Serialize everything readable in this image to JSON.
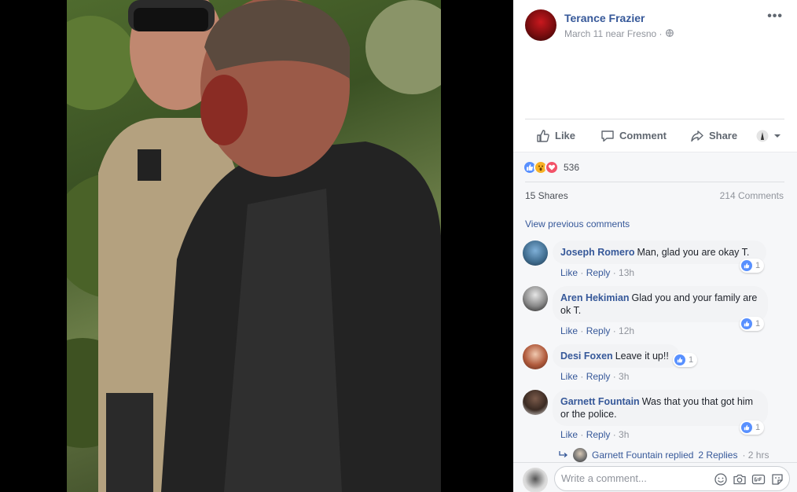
{
  "post": {
    "author": "Terance Frazier",
    "meta": "March 11 near Fresno ·",
    "more_icon": "more-horizontal-icon",
    "privacy_icon": "globe-icon"
  },
  "actions": {
    "like": "Like",
    "comment": "Comment",
    "share": "Share"
  },
  "stats": {
    "reaction_count": "536",
    "shares": "15 Shares",
    "comments": "214 Comments"
  },
  "view_previous": "View previous comments",
  "comments": [
    {
      "name": "Joseph Romero",
      "text": "Man, glad you are okay T.",
      "like": "Like",
      "reply": "Reply",
      "time": "13h",
      "likes": "1"
    },
    {
      "name": "Aren Hekimian",
      "text": "Glad you and your family are ok T.",
      "like": "Like",
      "reply": "Reply",
      "time": "12h",
      "likes": "1"
    },
    {
      "name": "Desi Foxen",
      "text": "Leave it up!!",
      "like": "Like",
      "reply": "Reply",
      "time": "3h",
      "likes": "1"
    },
    {
      "name": "Garnett Fountain",
      "text": "Was that you that got him or the police.",
      "like": "Like",
      "reply": "Reply",
      "time": "3h",
      "likes": "1"
    }
  ],
  "reply_summary": {
    "who": "Garnett Fountain replied",
    "count": "2 Replies",
    "time": "· 2 hrs"
  },
  "composer": {
    "placeholder": "Write a comment..."
  },
  "colors": {
    "link": "#365899",
    "like_blue": "#5890ff",
    "muted": "#90949c"
  }
}
